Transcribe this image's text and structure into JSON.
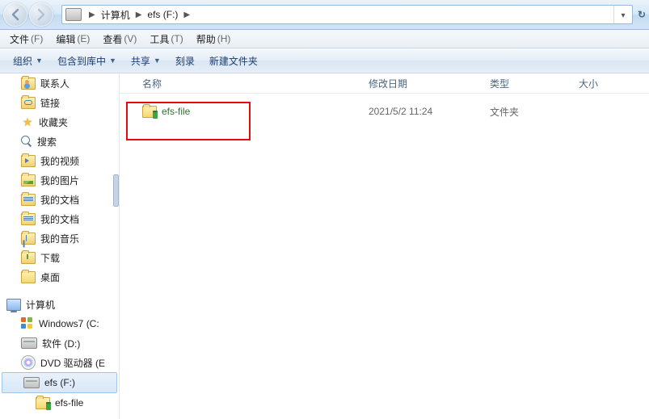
{
  "breadcrumb": {
    "root": "计算机",
    "drive": "efs (F:)"
  },
  "menubar": {
    "items": [
      {
        "label": "文件",
        "hotkey": "(F)"
      },
      {
        "label": "编辑",
        "hotkey": "(E)"
      },
      {
        "label": "查看",
        "hotkey": "(V)"
      },
      {
        "label": "工具",
        "hotkey": "(T)"
      },
      {
        "label": "帮助",
        "hotkey": "(H)"
      }
    ]
  },
  "toolbar": {
    "items": [
      {
        "label": "组织",
        "dropdown": true
      },
      {
        "label": "包含到库中",
        "dropdown": true
      },
      {
        "label": "共享",
        "dropdown": true
      },
      {
        "label": "刻录",
        "dropdown": false
      },
      {
        "label": "新建文件夹",
        "dropdown": false
      }
    ]
  },
  "columns": {
    "name": "名称",
    "date": "修改日期",
    "type": "类型",
    "size": "大小"
  },
  "files": [
    {
      "name": "efs-file",
      "date": "2021/5/2 11:24",
      "type": "文件夹",
      "size": ""
    }
  ],
  "sidebar": {
    "items": [
      {
        "label": "联系人",
        "icon": "people",
        "indent": 1
      },
      {
        "label": "链接",
        "icon": "link",
        "indent": 1
      },
      {
        "label": "收藏夹",
        "icon": "fav",
        "indent": 1
      },
      {
        "label": "搜索",
        "icon": "search",
        "indent": 1
      },
      {
        "label": "我的视频",
        "icon": "video",
        "indent": 1
      },
      {
        "label": "我的图片",
        "icon": "pic",
        "indent": 1
      },
      {
        "label": "我的文档",
        "icon": "doc",
        "indent": 1
      },
      {
        "label": "我的文档",
        "icon": "doc",
        "indent": 1
      },
      {
        "label": "我的音乐",
        "icon": "music",
        "indent": 1
      },
      {
        "label": "下载",
        "icon": "arrow",
        "indent": 1
      },
      {
        "label": "桌面",
        "icon": "folder",
        "indent": 1
      },
      {
        "label": "",
        "icon": "spacer",
        "indent": 0
      },
      {
        "label": "计算机",
        "icon": "monitor",
        "indent": 0
      },
      {
        "label": "Windows7 (C:",
        "icon": "win",
        "indent": 1
      },
      {
        "label": "软件 (D:)",
        "icon": "drive",
        "indent": 1
      },
      {
        "label": "DVD 驱动器 (E",
        "icon": "dvd",
        "indent": 1
      },
      {
        "label": "efs (F:)",
        "icon": "drive",
        "indent": 1,
        "selected": true
      },
      {
        "label": "efs-file",
        "icon": "lockfolder",
        "indent": 2
      }
    ]
  }
}
